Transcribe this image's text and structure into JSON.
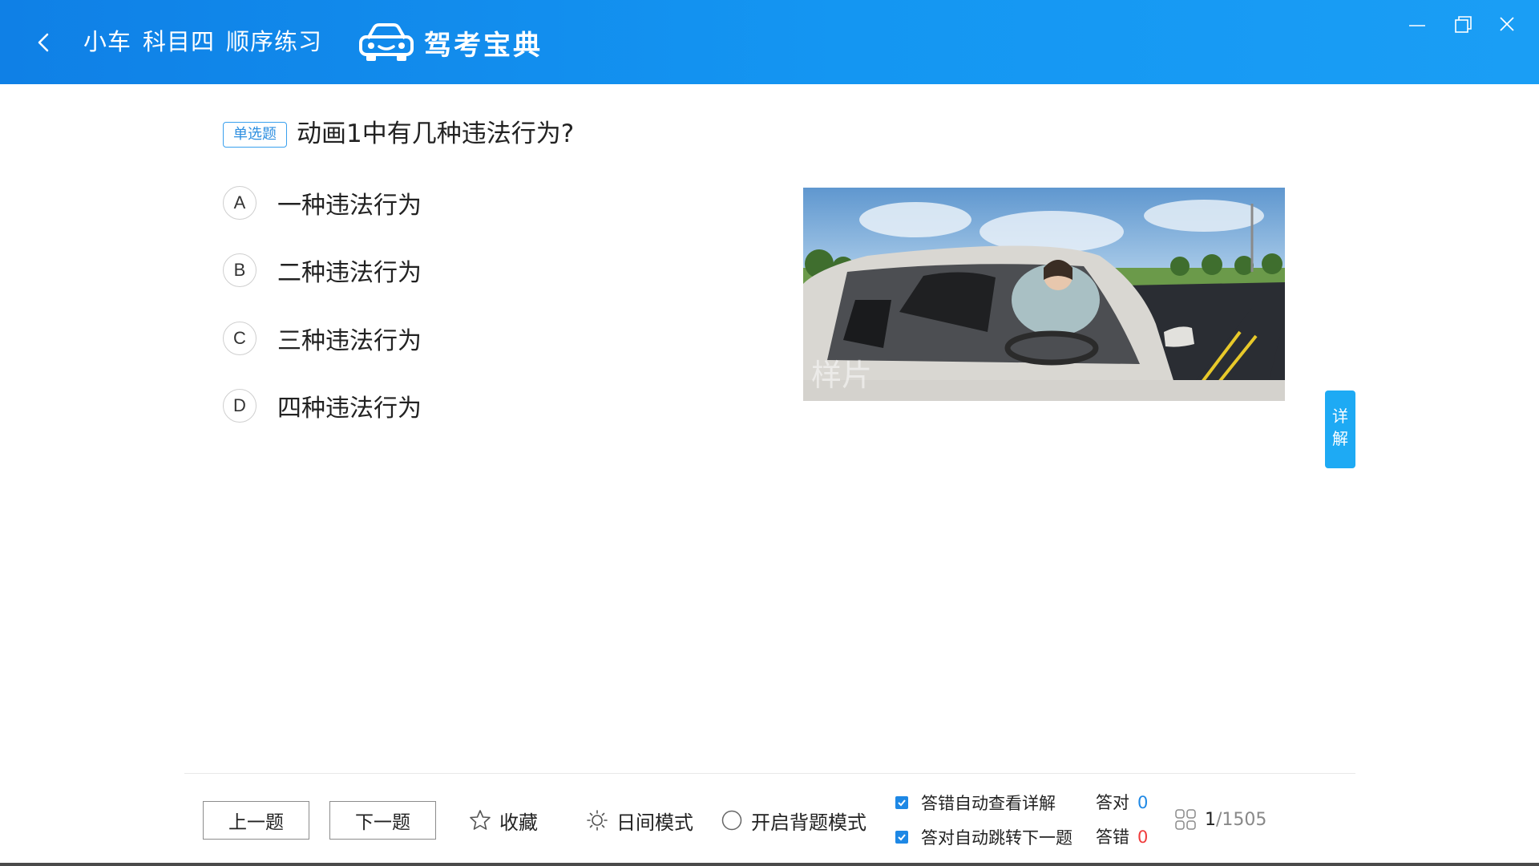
{
  "header": {
    "breadcrumb": [
      "小车",
      "科目四",
      "顺序练习"
    ],
    "logo_text": "驾考宝典"
  },
  "question": {
    "type_label": "单选题",
    "text": "动画1中有几种违法行为?",
    "options": [
      {
        "letter": "A",
        "text": "一种违法行为"
      },
      {
        "letter": "B",
        "text": "二种违法行为"
      },
      {
        "letter": "C",
        "text": "三种违法行为"
      },
      {
        "letter": "D",
        "text": "四种违法行为"
      }
    ],
    "media_watermark": "样片"
  },
  "detail_tab": [
    "详",
    "解"
  ],
  "footer": {
    "prev_label": "上一题",
    "next_label": "下一题",
    "favorite_label": "收藏",
    "day_mode_label": "日间模式",
    "memorize_label": "开启背题模式",
    "auto_detail_label": "答错自动查看详解",
    "auto_next_label": "答对自动跳转下一题",
    "correct_label": "答对",
    "correct_count": "0",
    "wrong_label": "答错",
    "wrong_count": "0",
    "progress_current": "1",
    "progress_total": "/1505"
  },
  "colors": {
    "header_blue": "#1496f2",
    "accent_blue": "#1e88e5",
    "wrong_red": "#f03c3c",
    "detail_tab": "#1eaaf4"
  },
  "icons": [
    "back-icon",
    "car-logo-icon",
    "minimize-icon",
    "restore-icon",
    "close-icon",
    "star-icon",
    "sun-icon",
    "circle-radio-icon",
    "checkbox-checked-icon",
    "grid-icon"
  ]
}
